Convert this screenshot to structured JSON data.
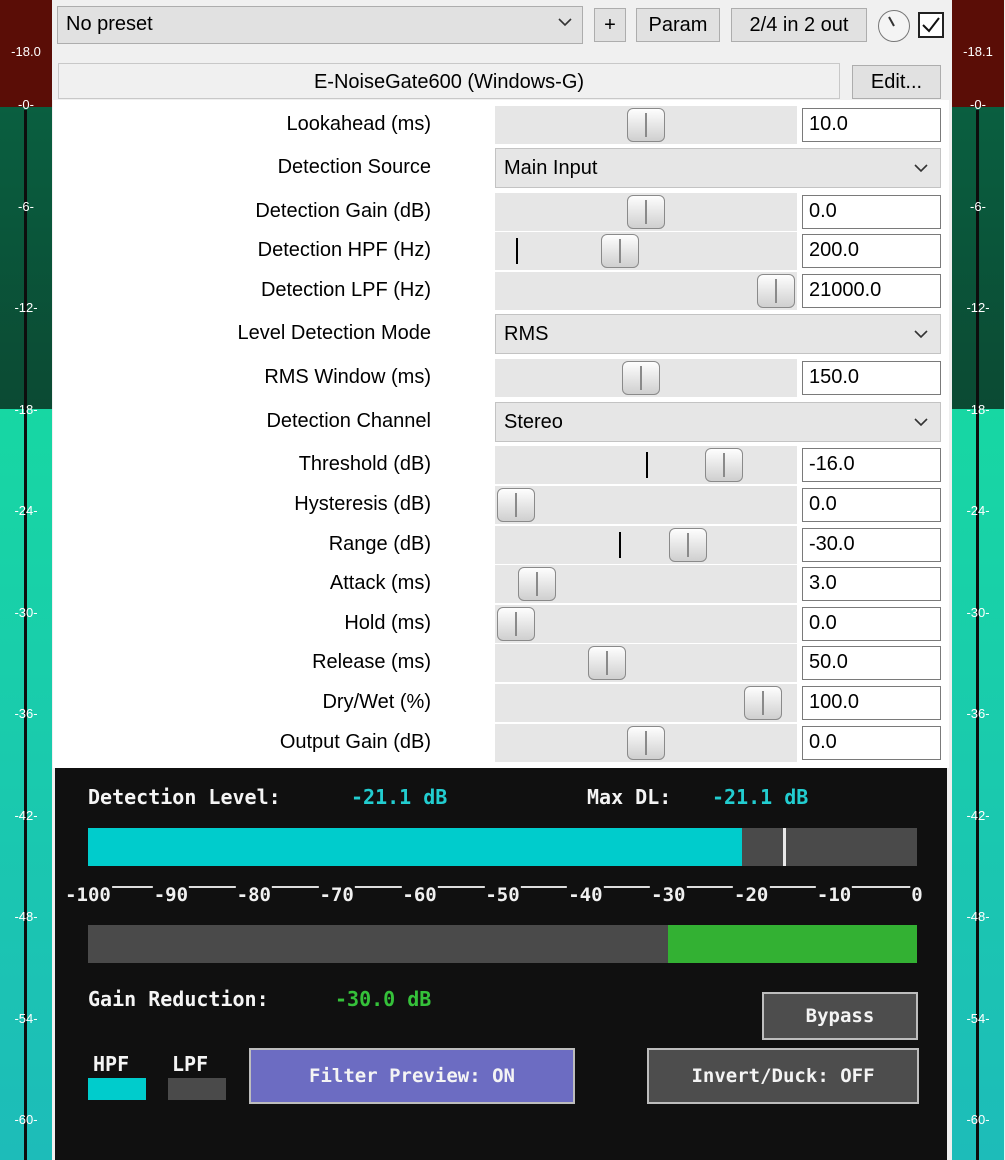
{
  "meters": {
    "left": {
      "peak": "-18.0",
      "ticks": [
        "-0-",
        "-6-",
        "-12-",
        "-18-",
        "-24-",
        "-30-",
        "-36-",
        "-42-",
        "-48-",
        "-54-",
        "-60-"
      ]
    },
    "right": {
      "peak": "-18.1",
      "ticks": [
        "-0-",
        "-6-",
        "-12-",
        "-18-",
        "-24-",
        "-30-",
        "-36-",
        "-42-",
        "-48-",
        "-54-",
        "-60-"
      ]
    }
  },
  "toolbar": {
    "preset": "No preset",
    "add_label": "+",
    "param_label": "Param",
    "io_label": "2/4 in 2 out"
  },
  "plugin": {
    "name": "E-NoiseGate600 (Windows-G)",
    "edit_label": "Edit..."
  },
  "params": [
    {
      "label": "Lookahead (ms)",
      "kind": "slider",
      "value": "10.0"
    },
    {
      "label": "Detection Source",
      "kind": "dropdown",
      "value": "Main Input"
    },
    {
      "label": "Detection Gain (dB)",
      "kind": "slider",
      "value": "0.0"
    },
    {
      "label": "Detection HPF (Hz)",
      "kind": "slider",
      "value": "200.0"
    },
    {
      "label": "Detection LPF (Hz)",
      "kind": "slider",
      "value": "21000.0"
    },
    {
      "label": "Level Detection Mode",
      "kind": "dropdown",
      "value": "RMS"
    },
    {
      "label": "RMS Window (ms)",
      "kind": "slider",
      "value": "150.0"
    },
    {
      "label": "Detection Channel",
      "kind": "dropdown",
      "value": "Stereo"
    },
    {
      "label": "Threshold (dB)",
      "kind": "slider",
      "value": "-16.0"
    },
    {
      "label": "Hysteresis (dB)",
      "kind": "slider",
      "value": "0.0"
    },
    {
      "label": "Range (dB)",
      "kind": "slider",
      "value": "-30.0"
    },
    {
      "label": "Attack (ms)",
      "kind": "slider",
      "value": "3.0"
    },
    {
      "label": "Hold (ms)",
      "kind": "slider",
      "value": "0.0"
    },
    {
      "label": "Release (ms)",
      "kind": "slider",
      "value": "50.0"
    },
    {
      "label": "Dry/Wet (%)",
      "kind": "slider",
      "value": "100.0"
    },
    {
      "label": "Output Gain (dB)",
      "kind": "slider",
      "value": "0.0"
    }
  ],
  "slider_levels": [
    0.5,
    0.5,
    0.4,
    1.0,
    0.48,
    0.8,
    0.0,
    0.66,
    0.08,
    0.0,
    0.35,
    0.95,
    0.5
  ],
  "slider_defaults": [
    null,
    null,
    0.07,
    null,
    null,
    0.5,
    null,
    0.41,
    null,
    null,
    null,
    null,
    null
  ],
  "display": {
    "detection_label": "Detection Level:",
    "detection_value": "-21.1 dB",
    "max_label": "Max DL:",
    "max_value": "-21.1 dB",
    "level_db": -21.1,
    "threshold_db": -16,
    "gr_label": "Gain Reduction:",
    "gr_value": "-30.0 dB",
    "gr_db": -30,
    "scale": [
      "-100",
      "-90",
      "-80",
      "-70",
      "-60",
      "-50",
      "-40",
      "-30",
      "-20",
      "-10",
      "0"
    ],
    "bypass_label": "Bypass",
    "hpf_label": "HPF",
    "lpf_label": "LPF",
    "filter_preview_label": "Filter Preview: ON",
    "invert_label": "Invert/Duck: OFF",
    "colors": {
      "level": "#00cccc",
      "gain_reduction": "#33b133",
      "hpf": "#00cccc",
      "lpf": "#4a4a4a",
      "filter_preview": "#6c6cc2"
    }
  }
}
